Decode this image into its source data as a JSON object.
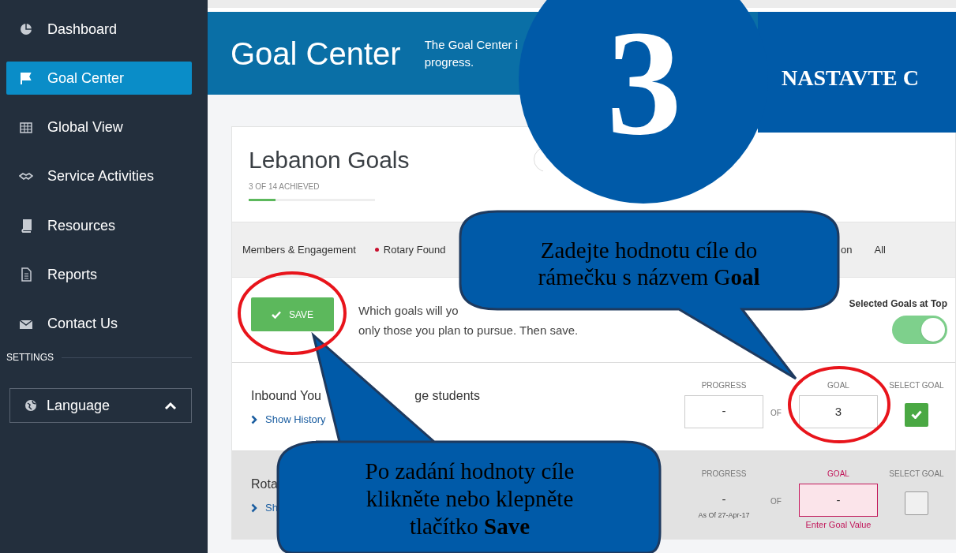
{
  "sidebar": {
    "items": [
      {
        "kind": "dashboard",
        "label": "Dashboard",
        "selected": false
      },
      {
        "kind": "flag",
        "label": "Goal Center",
        "selected": true
      },
      {
        "kind": "grid",
        "label": "Global View",
        "selected": false
      },
      {
        "kind": "handshake",
        "label": "Service Activities",
        "selected": false
      },
      {
        "kind": "book",
        "label": "Resources",
        "selected": false
      },
      {
        "kind": "report",
        "label": "Reports",
        "selected": false
      },
      {
        "kind": "mail",
        "label": "Contact Us",
        "selected": false
      }
    ],
    "settings_heading": "SETTINGS",
    "language": {
      "label": "Language",
      "expanded": true
    }
  },
  "header": {
    "title": "Goal Center",
    "description_lines": [
      "The Goal Center i",
      "progress."
    ]
  },
  "goals_card": {
    "title": "Lebanon Goals",
    "achieved": "3 OF 14 ACHIEVED",
    "level": 0.21,
    "tabs": [
      {
        "label": "Members & Engagement",
        "marked": false
      },
      {
        "label": "Rotary Found",
        "marked": true
      },
      {
        "label": "on",
        "marked": false
      },
      {
        "label": "All",
        "marked": false
      }
    ],
    "save_button": "SAVE",
    "instructions": [
      "Which goals will yo",
      "only those you plan to pursue. Then save."
    ],
    "toggle": {
      "label": "Selected Goals at Top",
      "on": true
    },
    "goals": [
      {
        "name_parts": [
          "Inbound You",
          "ge students"
        ],
        "history_link": "Show History",
        "progress_label": "PROGRESS",
        "progress": "-",
        "of": "OF",
        "goal_label": "GOAL",
        "goal": "3",
        "select_label": "SELECT GOAL",
        "selected": true
      },
      {
        "name_parts": [
          "Rota"
        ],
        "history_link": "Sh",
        "progress_label": "PROGRESS",
        "progress": "-",
        "as_of": "As Of 27-Apr-17",
        "of": "OF",
        "goal_label": "GOAL",
        "goal": "-",
        "error": "Enter Goal Value",
        "select_label": "SELECT GOAL",
        "selected": false
      }
    ]
  },
  "annotations": {
    "step_number": "3",
    "step_banner": "NASTAVTE C",
    "callouts": [
      "Zadejte hodnotu cíle do rámečku s názvem G**oal**",
      "Po zadání hodnoty cíle klikněte nebo klepněte tlačítko **Save**"
    ]
  }
}
